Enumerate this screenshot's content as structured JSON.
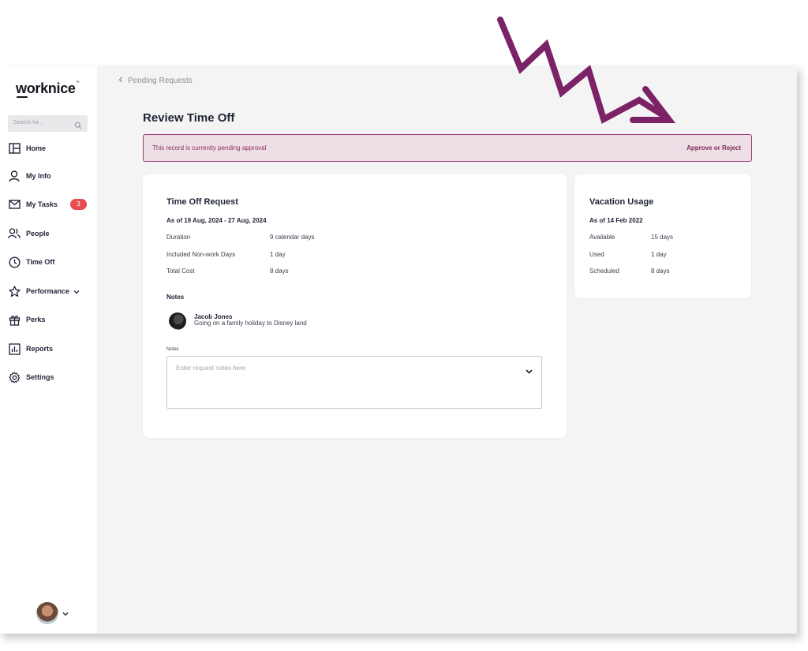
{
  "app": {
    "logo": "worknice"
  },
  "search": {
    "placeholder": "Search for..."
  },
  "sidebar": {
    "items": [
      {
        "label": "Home",
        "icon": "layout-icon"
      },
      {
        "label": "My Info",
        "icon": "user-icon"
      },
      {
        "label": "My Tasks",
        "icon": "mail-icon",
        "badge": "3"
      },
      {
        "label": "People",
        "icon": "people-icon"
      },
      {
        "label": "Time Off",
        "icon": "clock-icon"
      },
      {
        "label": "Performance",
        "icon": "star-icon"
      },
      {
        "label": "Perks",
        "icon": "gift-icon"
      },
      {
        "label": "Reports",
        "icon": "chart-icon"
      },
      {
        "label": "Settings",
        "icon": "gear-icon"
      }
    ]
  },
  "breadcrumb": {
    "label": "Pending Requests"
  },
  "page": {
    "title": "Review Time Off"
  },
  "alert": {
    "message": "This record is currently pending approval",
    "action": "Approve or Reject"
  },
  "request": {
    "title": "Time Off Request",
    "period": "As of 19 Aug, 2024 - 27 Aug, 2024",
    "rows": [
      {
        "label": "Duration",
        "value": "9 calendar days"
      },
      {
        "label": "Included Non-work Days",
        "value": "1 day"
      },
      {
        "label": "Total Cost",
        "value": "8 days"
      }
    ],
    "notes_heading": "Notes",
    "note": {
      "author": "Jacob Jones",
      "text": "Going on a family holiday to Disney land"
    },
    "notes_field": {
      "label": "Notes",
      "placeholder": "Enter request notes here"
    }
  },
  "vacation": {
    "title": "Vacation Usage",
    "as_of": "As of 14 Feb 2022",
    "rows": [
      {
        "label": "Available",
        "value": "15 days"
      },
      {
        "label": "Used",
        "value": "1 day"
      },
      {
        "label": "Scheduled",
        "value": "8 days"
      }
    ]
  },
  "colors": {
    "accent": "#8a2f63",
    "arrow": "#7c2266",
    "badge": "#e84c50",
    "background": "#f4f4f5"
  }
}
